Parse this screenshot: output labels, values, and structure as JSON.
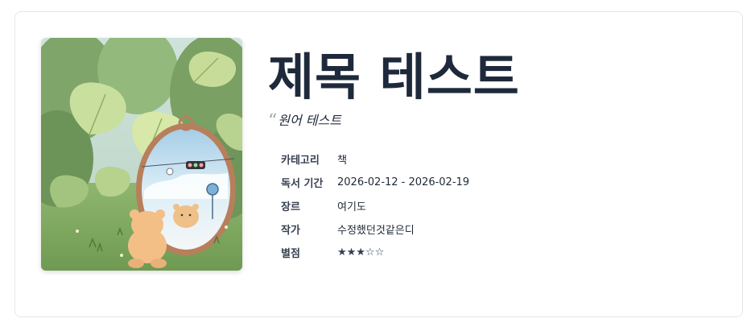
{
  "book": {
    "title": "제목 테스트",
    "original_title": "원어 테스트",
    "cover_icon": "book-cover-illustration",
    "quote_icon": "open-quote-icon",
    "quote_glyph": "“",
    "details": [
      {
        "key": "category",
        "label": "카테고리",
        "value": "책"
      },
      {
        "key": "reading-period",
        "label": "독서 기간",
        "value": "2026-02-12 - 2026-02-19"
      },
      {
        "key": "genre",
        "label": "장르",
        "value": "여기도"
      },
      {
        "key": "author",
        "label": "작가",
        "value": "수정했던것같은디"
      },
      {
        "key": "rating",
        "label": "별점",
        "value": "★★★☆☆"
      }
    ],
    "rating_value": 3,
    "rating_max": 5
  },
  "colors": {
    "title": "#1e293b",
    "border": "#e5e7eb",
    "label": "#374151"
  }
}
